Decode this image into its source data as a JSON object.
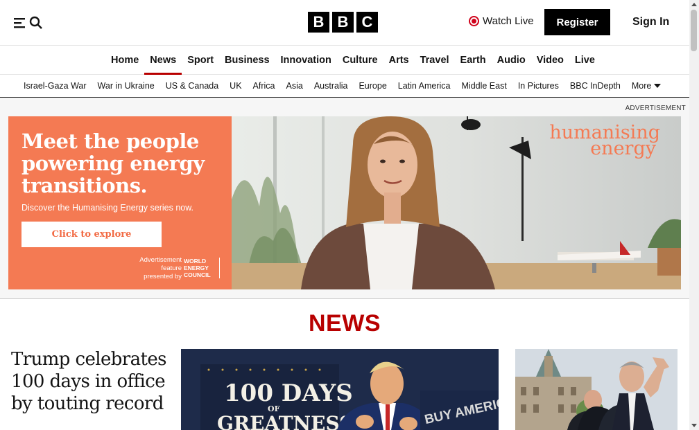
{
  "header": {
    "logo_letters": [
      "B",
      "B",
      "C"
    ],
    "watch_live": "Watch Live",
    "register": "Register",
    "sign_in": "Sign In"
  },
  "nav": {
    "items": [
      "Home",
      "News",
      "Sport",
      "Business",
      "Innovation",
      "Culture",
      "Arts",
      "Travel",
      "Earth",
      "Audio",
      "Video",
      "Live"
    ],
    "active": "News"
  },
  "subnav": {
    "items": [
      "Israel-Gaza War",
      "War in Ukraine",
      "US & Canada",
      "UK",
      "Africa",
      "Asia",
      "Australia",
      "Europe",
      "Latin America",
      "Middle East",
      "In Pictures",
      "BBC InDepth"
    ],
    "more": "More"
  },
  "ad": {
    "label": "ADVERTISEMENT",
    "headline": "Meet the people powering energy transitions.",
    "subtext": "Discover the Humanising Energy series now.",
    "button": "Click to explore",
    "feature_text": "Advertisement feature presented by",
    "sponsor": "WORLD ENERGY COUNCIL",
    "brand_line1": "humanising",
    "brand_line2": "energy"
  },
  "section": {
    "title": "NEWS"
  },
  "stories": {
    "lead_title": "Trump celebrates 100 days in office by touting record",
    "lead_image_sign_line1": "100 DAYS",
    "lead_image_sign_line2": "OF",
    "lead_image_sign_line3": "GREATNESS",
    "lead_image_sign_right": "BUY AMERICA"
  },
  "colors": {
    "brand_red": "#b80000",
    "ad_orange": "#f47a53",
    "live_red": "#d0021b"
  }
}
